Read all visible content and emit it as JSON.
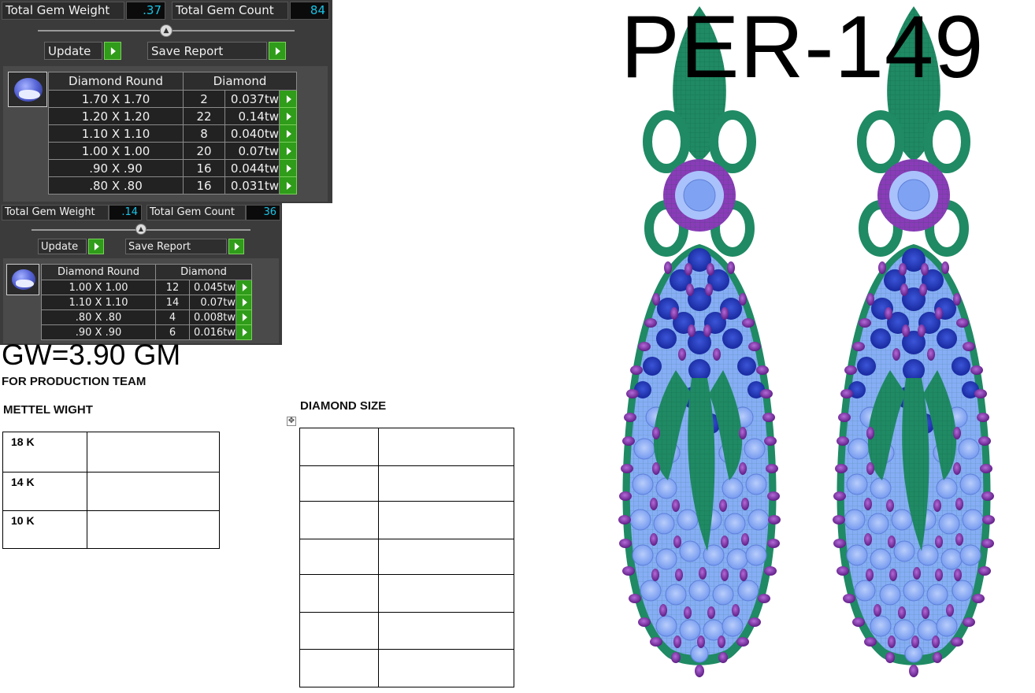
{
  "panel_top": {
    "total_gem_weight_label": "Total Gem Weight",
    "total_gem_weight_value": ".37",
    "total_gem_count_label": "Total Gem Count",
    "total_gem_count_value": "84",
    "update_label": "Update",
    "save_report_label": "Save Report",
    "table_header": [
      "Diamond Round",
      "Diamond"
    ],
    "rows": [
      {
        "size": "1.70 X 1.70",
        "count": "2",
        "weight": "0.037tw"
      },
      {
        "size": "1.20 X 1.20",
        "count": "22",
        "weight": "0.14tw"
      },
      {
        "size": "1.10 X 1.10",
        "count": "8",
        "weight": "0.040tw"
      },
      {
        "size": "1.00 X 1.00",
        "count": "20",
        "weight": "0.07tw"
      },
      {
        "size": ".90 X .90",
        "count": "16",
        "weight": "0.044tw"
      },
      {
        "size": ".80 X .80",
        "count": "16",
        "weight": "0.031tw"
      }
    ]
  },
  "panel_bottom": {
    "total_gem_weight_label": "Total Gem Weight",
    "total_gem_weight_value": ".14",
    "total_gem_count_label": "Total Gem Count",
    "total_gem_count_value": "36",
    "update_label": "Update",
    "save_report_label": "Save Report",
    "table_header": [
      "Diamond Round",
      "Diamond"
    ],
    "rows": [
      {
        "size": "1.00 X 1.00",
        "count": "12",
        "weight": "0.045tw"
      },
      {
        "size": "1.10 X 1.10",
        "count": "14",
        "weight": "0.07tw"
      },
      {
        "size": ".80 X .80",
        "count": "4",
        "weight": "0.008tw"
      },
      {
        "size": ".90 X .90",
        "count": "6",
        "weight": "0.016tw"
      }
    ]
  },
  "gross_weight": "GW=3.90 GM",
  "production_note": "FOR PRODUCTION TEAM",
  "metal_weight_title": "METTEL WIGHT",
  "metal_rows": [
    "18 K",
    "14 K",
    "10 K"
  ],
  "diamond_size_title": "DIAMOND SIZE",
  "design_code": "PER-149",
  "colors": {
    "panel_bg": "#3b3b3b",
    "value_text": "#19c3e6",
    "go_button": "#2f9c1a",
    "metal_green": "#1f8a64",
    "gem_purple": "#7a2ea8",
    "gem_blue_light": "#7fa3f2",
    "gem_blue_dark": "#1f35b0"
  }
}
